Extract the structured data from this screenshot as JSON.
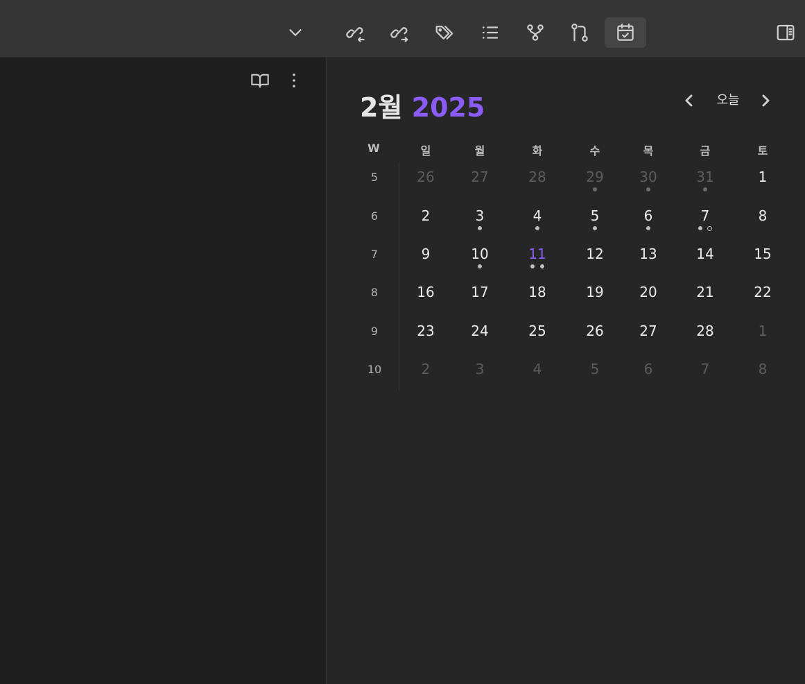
{
  "toolbar": {
    "icons": [
      "chevron-down-icon",
      "backlinks-icon",
      "outgoing-links-icon",
      "tags-icon",
      "outline-icon",
      "graph-icon",
      "git-icon",
      "calendar-icon"
    ],
    "right_icon": "sidebar-toggle-icon"
  },
  "left_pane": {
    "icons": [
      "reading-view-icon",
      "more-options-icon"
    ]
  },
  "calendar": {
    "month": "2월",
    "year": "2025",
    "today_label": "오늘",
    "week_header": "W",
    "weekdays": [
      "일",
      "월",
      "화",
      "수",
      "목",
      "금",
      "토"
    ],
    "weeks": [
      {
        "num": "5",
        "days": [
          {
            "d": "26",
            "adj": true
          },
          {
            "d": "27",
            "adj": true
          },
          {
            "d": "28",
            "adj": true
          },
          {
            "d": "29",
            "adj": true,
            "dots": 1
          },
          {
            "d": "30",
            "adj": true,
            "dots": 1
          },
          {
            "d": "31",
            "adj": true,
            "dots": 1
          },
          {
            "d": "1"
          }
        ]
      },
      {
        "num": "6",
        "days": [
          {
            "d": "2"
          },
          {
            "d": "3",
            "dots": 1
          },
          {
            "d": "4",
            "dots": 1
          },
          {
            "d": "5",
            "dots": 1
          },
          {
            "d": "6",
            "dots": 1
          },
          {
            "d": "7",
            "dots": 1,
            "hollow": 1
          },
          {
            "d": "8"
          }
        ]
      },
      {
        "num": "7",
        "days": [
          {
            "d": "9"
          },
          {
            "d": "10",
            "dots": 1
          },
          {
            "d": "11",
            "today": true,
            "dots": 2
          },
          {
            "d": "12"
          },
          {
            "d": "13"
          },
          {
            "d": "14"
          },
          {
            "d": "15"
          }
        ]
      },
      {
        "num": "8",
        "days": [
          {
            "d": "16"
          },
          {
            "d": "17"
          },
          {
            "d": "18"
          },
          {
            "d": "19"
          },
          {
            "d": "20"
          },
          {
            "d": "21"
          },
          {
            "d": "22"
          }
        ]
      },
      {
        "num": "9",
        "days": [
          {
            "d": "23"
          },
          {
            "d": "24"
          },
          {
            "d": "25"
          },
          {
            "d": "26"
          },
          {
            "d": "27"
          },
          {
            "d": "28"
          },
          {
            "d": "1",
            "adj": true
          }
        ]
      },
      {
        "num": "10",
        "days": [
          {
            "d": "2",
            "adj": true
          },
          {
            "d": "3",
            "adj": true
          },
          {
            "d": "4",
            "adj": true
          },
          {
            "d": "5",
            "adj": true
          },
          {
            "d": "6",
            "adj": true
          },
          {
            "d": "7",
            "adj": true
          },
          {
            "d": "8",
            "adj": true
          }
        ]
      }
    ]
  },
  "colors": {
    "accent": "#8a5cf5",
    "background": "#262626",
    "left_pane": "#1f1f1f",
    "toolbar": "#353535"
  }
}
